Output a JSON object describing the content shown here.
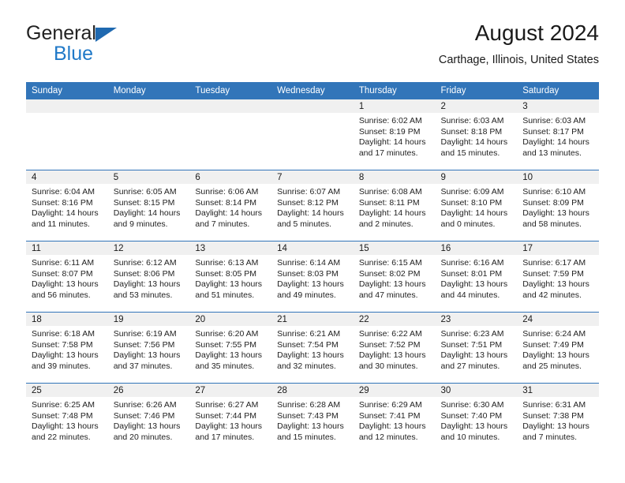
{
  "brand": {
    "name_top": "General",
    "name_bottom": "Blue",
    "triangle_color": "#1f69b0",
    "blue_color": "#2079c8"
  },
  "header": {
    "title": "August 2024",
    "subtitle": "Carthage, Illinois, United States"
  },
  "theme": {
    "header_blue": "#3275b9",
    "daynum_band": "#f0f0f0",
    "text": "#1a1a1a"
  },
  "weekday_headers": [
    "Sunday",
    "Monday",
    "Tuesday",
    "Wednesday",
    "Thursday",
    "Friday",
    "Saturday"
  ],
  "weeks": [
    [
      {
        "day": "",
        "sunrise": "",
        "sunset": "",
        "daylight_1": "",
        "daylight_2": ""
      },
      {
        "day": "",
        "sunrise": "",
        "sunset": "",
        "daylight_1": "",
        "daylight_2": ""
      },
      {
        "day": "",
        "sunrise": "",
        "sunset": "",
        "daylight_1": "",
        "daylight_2": ""
      },
      {
        "day": "",
        "sunrise": "",
        "sunset": "",
        "daylight_1": "",
        "daylight_2": ""
      },
      {
        "day": "1",
        "sunrise": "Sunrise: 6:02 AM",
        "sunset": "Sunset: 8:19 PM",
        "daylight_1": "Daylight: 14 hours",
        "daylight_2": "and 17 minutes."
      },
      {
        "day": "2",
        "sunrise": "Sunrise: 6:03 AM",
        "sunset": "Sunset: 8:18 PM",
        "daylight_1": "Daylight: 14 hours",
        "daylight_2": "and 15 minutes."
      },
      {
        "day": "3",
        "sunrise": "Sunrise: 6:03 AM",
        "sunset": "Sunset: 8:17 PM",
        "daylight_1": "Daylight: 14 hours",
        "daylight_2": "and 13 minutes."
      }
    ],
    [
      {
        "day": "4",
        "sunrise": "Sunrise: 6:04 AM",
        "sunset": "Sunset: 8:16 PM",
        "daylight_1": "Daylight: 14 hours",
        "daylight_2": "and 11 minutes."
      },
      {
        "day": "5",
        "sunrise": "Sunrise: 6:05 AM",
        "sunset": "Sunset: 8:15 PM",
        "daylight_1": "Daylight: 14 hours",
        "daylight_2": "and 9 minutes."
      },
      {
        "day": "6",
        "sunrise": "Sunrise: 6:06 AM",
        "sunset": "Sunset: 8:14 PM",
        "daylight_1": "Daylight: 14 hours",
        "daylight_2": "and 7 minutes."
      },
      {
        "day": "7",
        "sunrise": "Sunrise: 6:07 AM",
        "sunset": "Sunset: 8:12 PM",
        "daylight_1": "Daylight: 14 hours",
        "daylight_2": "and 5 minutes."
      },
      {
        "day": "8",
        "sunrise": "Sunrise: 6:08 AM",
        "sunset": "Sunset: 8:11 PM",
        "daylight_1": "Daylight: 14 hours",
        "daylight_2": "and 2 minutes."
      },
      {
        "day": "9",
        "sunrise": "Sunrise: 6:09 AM",
        "sunset": "Sunset: 8:10 PM",
        "daylight_1": "Daylight: 14 hours",
        "daylight_2": "and 0 minutes."
      },
      {
        "day": "10",
        "sunrise": "Sunrise: 6:10 AM",
        "sunset": "Sunset: 8:09 PM",
        "daylight_1": "Daylight: 13 hours",
        "daylight_2": "and 58 minutes."
      }
    ],
    [
      {
        "day": "11",
        "sunrise": "Sunrise: 6:11 AM",
        "sunset": "Sunset: 8:07 PM",
        "daylight_1": "Daylight: 13 hours",
        "daylight_2": "and 56 minutes."
      },
      {
        "day": "12",
        "sunrise": "Sunrise: 6:12 AM",
        "sunset": "Sunset: 8:06 PM",
        "daylight_1": "Daylight: 13 hours",
        "daylight_2": "and 53 minutes."
      },
      {
        "day": "13",
        "sunrise": "Sunrise: 6:13 AM",
        "sunset": "Sunset: 8:05 PM",
        "daylight_1": "Daylight: 13 hours",
        "daylight_2": "and 51 minutes."
      },
      {
        "day": "14",
        "sunrise": "Sunrise: 6:14 AM",
        "sunset": "Sunset: 8:03 PM",
        "daylight_1": "Daylight: 13 hours",
        "daylight_2": "and 49 minutes."
      },
      {
        "day": "15",
        "sunrise": "Sunrise: 6:15 AM",
        "sunset": "Sunset: 8:02 PM",
        "daylight_1": "Daylight: 13 hours",
        "daylight_2": "and 47 minutes."
      },
      {
        "day": "16",
        "sunrise": "Sunrise: 6:16 AM",
        "sunset": "Sunset: 8:01 PM",
        "daylight_1": "Daylight: 13 hours",
        "daylight_2": "and 44 minutes."
      },
      {
        "day": "17",
        "sunrise": "Sunrise: 6:17 AM",
        "sunset": "Sunset: 7:59 PM",
        "daylight_1": "Daylight: 13 hours",
        "daylight_2": "and 42 minutes."
      }
    ],
    [
      {
        "day": "18",
        "sunrise": "Sunrise: 6:18 AM",
        "sunset": "Sunset: 7:58 PM",
        "daylight_1": "Daylight: 13 hours",
        "daylight_2": "and 39 minutes."
      },
      {
        "day": "19",
        "sunrise": "Sunrise: 6:19 AM",
        "sunset": "Sunset: 7:56 PM",
        "daylight_1": "Daylight: 13 hours",
        "daylight_2": "and 37 minutes."
      },
      {
        "day": "20",
        "sunrise": "Sunrise: 6:20 AM",
        "sunset": "Sunset: 7:55 PM",
        "daylight_1": "Daylight: 13 hours",
        "daylight_2": "and 35 minutes."
      },
      {
        "day": "21",
        "sunrise": "Sunrise: 6:21 AM",
        "sunset": "Sunset: 7:54 PM",
        "daylight_1": "Daylight: 13 hours",
        "daylight_2": "and 32 minutes."
      },
      {
        "day": "22",
        "sunrise": "Sunrise: 6:22 AM",
        "sunset": "Sunset: 7:52 PM",
        "daylight_1": "Daylight: 13 hours",
        "daylight_2": "and 30 minutes."
      },
      {
        "day": "23",
        "sunrise": "Sunrise: 6:23 AM",
        "sunset": "Sunset: 7:51 PM",
        "daylight_1": "Daylight: 13 hours",
        "daylight_2": "and 27 minutes."
      },
      {
        "day": "24",
        "sunrise": "Sunrise: 6:24 AM",
        "sunset": "Sunset: 7:49 PM",
        "daylight_1": "Daylight: 13 hours",
        "daylight_2": "and 25 minutes."
      }
    ],
    [
      {
        "day": "25",
        "sunrise": "Sunrise: 6:25 AM",
        "sunset": "Sunset: 7:48 PM",
        "daylight_1": "Daylight: 13 hours",
        "daylight_2": "and 22 minutes."
      },
      {
        "day": "26",
        "sunrise": "Sunrise: 6:26 AM",
        "sunset": "Sunset: 7:46 PM",
        "daylight_1": "Daylight: 13 hours",
        "daylight_2": "and 20 minutes."
      },
      {
        "day": "27",
        "sunrise": "Sunrise: 6:27 AM",
        "sunset": "Sunset: 7:44 PM",
        "daylight_1": "Daylight: 13 hours",
        "daylight_2": "and 17 minutes."
      },
      {
        "day": "28",
        "sunrise": "Sunrise: 6:28 AM",
        "sunset": "Sunset: 7:43 PM",
        "daylight_1": "Daylight: 13 hours",
        "daylight_2": "and 15 minutes."
      },
      {
        "day": "29",
        "sunrise": "Sunrise: 6:29 AM",
        "sunset": "Sunset: 7:41 PM",
        "daylight_1": "Daylight: 13 hours",
        "daylight_2": "and 12 minutes."
      },
      {
        "day": "30",
        "sunrise": "Sunrise: 6:30 AM",
        "sunset": "Sunset: 7:40 PM",
        "daylight_1": "Daylight: 13 hours",
        "daylight_2": "and 10 minutes."
      },
      {
        "day": "31",
        "sunrise": "Sunrise: 6:31 AM",
        "sunset": "Sunset: 7:38 PM",
        "daylight_1": "Daylight: 13 hours",
        "daylight_2": "and 7 minutes."
      }
    ]
  ]
}
